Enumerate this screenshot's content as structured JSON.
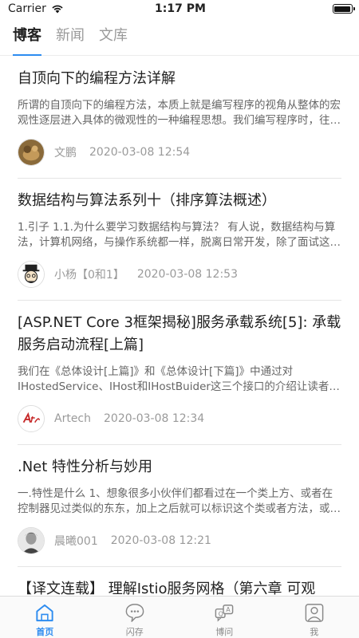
{
  "status_bar": {
    "carrier": "Carrier",
    "time": "1:17 PM",
    "battery_level": 1.0
  },
  "top_tabs": [
    {
      "label": "博客",
      "active": true
    },
    {
      "label": "新闻",
      "active": false
    },
    {
      "label": "文库",
      "active": false
    }
  ],
  "posts": [
    {
      "title": "自顶向下的编程方法详解",
      "summary": "所谓的自顶向下的编程方法，本质上就是编写程序的视角从整体的宏观性逐层进入具体的微观性的一种编程思想。我们编写程序时，往往会先想好整体思路，然后再……",
      "author": "文鹏",
      "time": "2020-03-08 12:54"
    },
    {
      "title": "数据结构与算法系列十（排序算法概述）",
      "summary": "1.引子 1.1.为什么要学习数据结构与算法？ 有人说，数据结构与算法，计算机网络，与操作系统都一样，脱离日常开发，除了面试这辈子可能都用不到……",
      "author": "小杨【0和1】",
      "time": "2020-03-08 12:53"
    },
    {
      "title": "[ASP.NET Core 3框架揭秘]服务承载系统[5]: 承载服务启动流程[上篇]",
      "summary": "我们在《总体设计[上篇]》和《总体设计[下篇]》中通过对IHostedService、IHost和IHostBuider这三个接口的介绍让读者朋友们……",
      "author": "Artech",
      "time": "2020-03-08 12:34"
    },
    {
      "title": ".Net 特性分析与妙用",
      "summary": "一.特性是什么 1、想象很多小伙伴们都看过在一个类上方、或者在控制器见过类似的东东，加上之后就可以标识这个类或者方法，或者……",
      "author": "晨曦001",
      "time": "2020-03-08 12:21"
    },
    {
      "title": "【译文连载】 理解Istio服务网格（第六章 可观",
      "summary": "",
      "author": "",
      "time": ""
    }
  ],
  "bottom_tabs": [
    {
      "label": "首页",
      "icon": "home-icon",
      "active": true
    },
    {
      "label": "闪存",
      "icon": "flash-chat-icon",
      "active": false
    },
    {
      "label": "博问",
      "icon": "qa-icon",
      "active": false
    },
    {
      "label": "我",
      "icon": "profile-icon",
      "active": false
    }
  ],
  "colors": {
    "accent": "#2d8cf0",
    "inactive": "#888888",
    "divider": "#e5e5e5"
  }
}
